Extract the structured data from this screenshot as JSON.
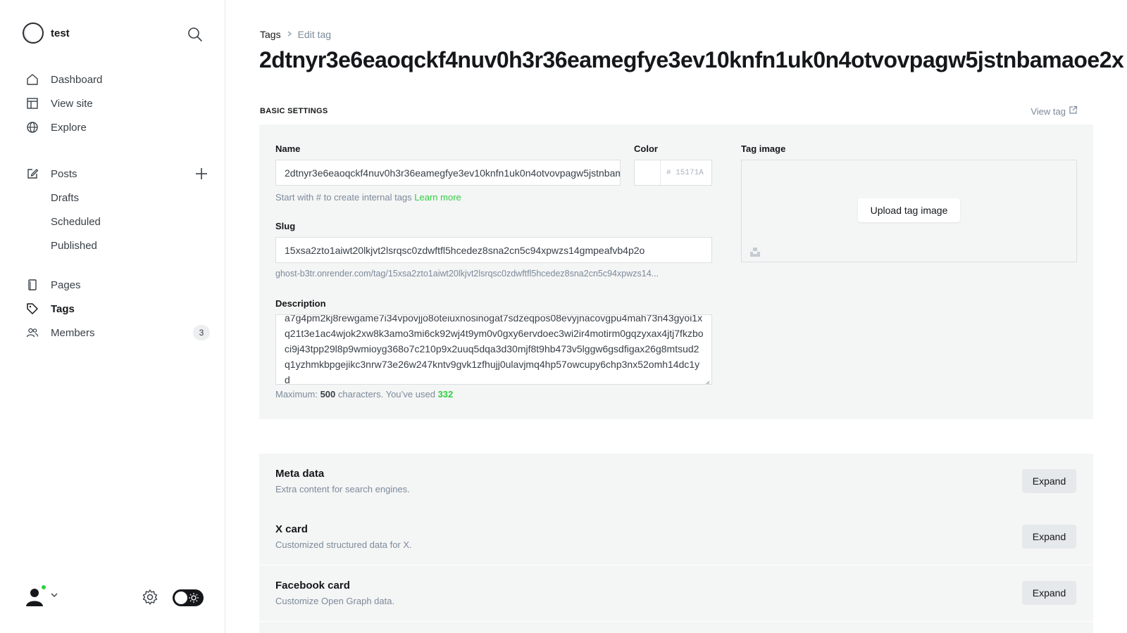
{
  "brand": {
    "name": "test"
  },
  "sidebar": {
    "items": [
      {
        "label": "Dashboard",
        "icon": "home-icon"
      },
      {
        "label": "View site",
        "icon": "layout-icon"
      },
      {
        "label": "Explore",
        "icon": "globe-icon"
      }
    ],
    "posts": {
      "label": "Posts",
      "icon": "edit-icon"
    },
    "post_subitems": [
      "Drafts",
      "Scheduled",
      "Published"
    ],
    "pages": {
      "label": "Pages",
      "icon": "pages-icon"
    },
    "tags": {
      "label": "Tags",
      "icon": "tag-icon"
    },
    "members": {
      "label": "Members",
      "icon": "members-icon",
      "count": "3"
    }
  },
  "breadcrumb": {
    "parent": "Tags",
    "current": "Edit tag"
  },
  "page": {
    "title": "2dtnyr3e6eaoqckf4nuv0h3r36eamegfye3ev10knfn1uk0n4otvovpagw5jstnbamaoe2x"
  },
  "basic_settings": {
    "section_label": "BASIC SETTINGS",
    "view_tag": "View tag",
    "name_label": "Name",
    "name_value": "2dtnyr3e6eaoqckf4nuv0h3r36eamegfye3ev10knfn1uk0n4otvovpagw5jstnbamaoe2x",
    "name_hint": "Start with # to create internal tags",
    "name_hint_link": "Learn more",
    "color_label": "Color",
    "color_value": "# 15171A",
    "slug_label": "Slug",
    "slug_value": "15xsa2zto1aiwt20lkjvt2lsrqsc0zdwftfl5hcedez8sna2cn5c94xpwzs14gmpeafvb4p2o",
    "slug_url": "ghost-b3tr.onrender.com/tag/15xsa2zto1aiwt20lkjvt2lsrqsc0zdwftfl5hcedez8sna2cn5c94xpwzs14...",
    "description_label": "Description",
    "description_value": "a7g4pm2kj8rewgame7i34vpovjjo8oteiuxnosinogat7sdzeqpos08evyjnacovgpu4mah73n43gyoi1xq21t3e1ac4wjok2xw8k3amo3mi6ck92wj4t9ym0v0gxy6ervdoec3wi2ir4motirm0gqzyxax4jtj7fkzboci9j43tpp29l8p9wmioyg368o7c210p9x2uuq5dqa3d30mjf8t9hb473v5lggw6gsdfigax26g8mtsud2q1yzhmkbpgejikc3nrw73e26w247kntv9gvk1zfhujj0ulavjmq4hp57owcupy6chp3nx52omh14dc1yd",
    "max_prefix": "Maximum:",
    "max_count": "500",
    "max_middle": "characters. You’ve used",
    "used_count": "332",
    "tag_image_label": "Tag image",
    "upload_label": "Upload tag image"
  },
  "cards": [
    {
      "title": "Meta data",
      "subtitle": "Extra content for search engines.",
      "button": "Expand"
    },
    {
      "title": "X card",
      "subtitle": "Customized structured data for X.",
      "button": "Expand"
    },
    {
      "title": "Facebook card",
      "subtitle": "Customize Open Graph data.",
      "button": "Expand"
    }
  ],
  "colors": {
    "accent": "#30cf43",
    "text": "#15171a",
    "panel": "#f4f5f5"
  }
}
